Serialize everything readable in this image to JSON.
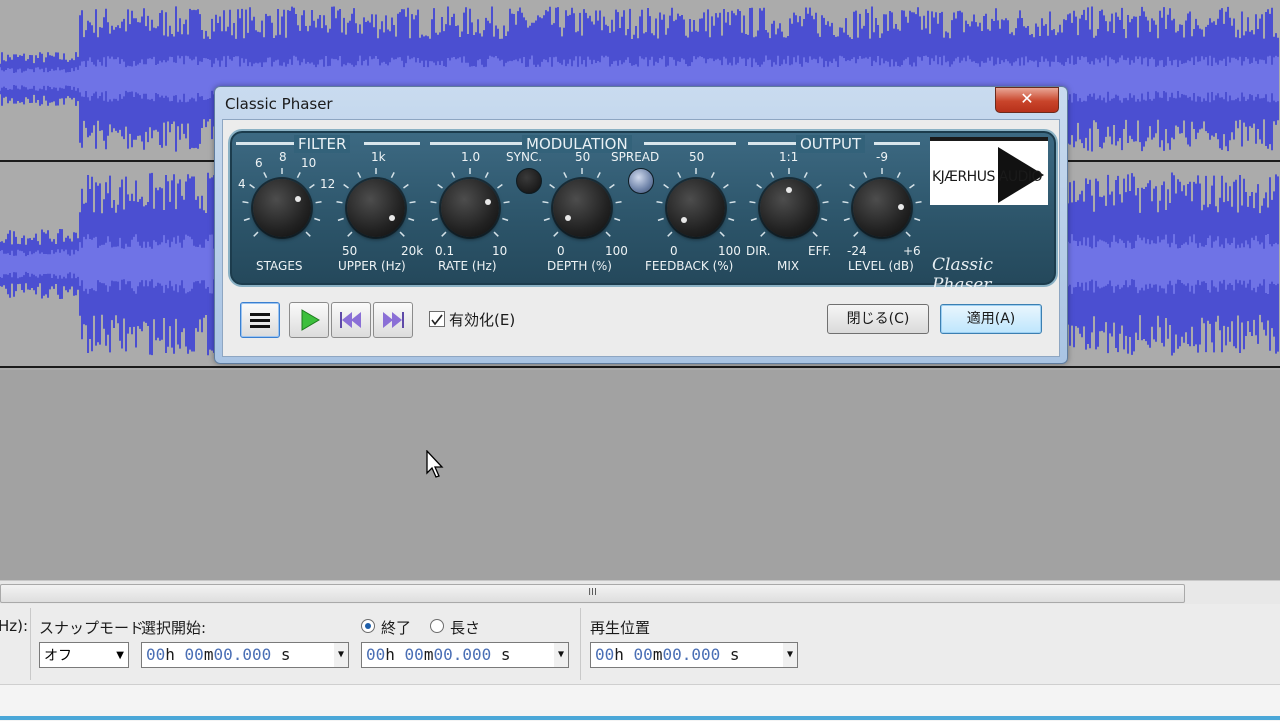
{
  "dialog": {
    "title": "Classic Phaser",
    "close_glyph": "✕",
    "sections": {
      "filter": "FILTER",
      "modulation": "MODULATION",
      "output": "OUTPUT"
    },
    "knobs": {
      "stages": {
        "label": "STAGES",
        "scale": [
          "4",
          "6",
          "8",
          "10",
          "12"
        ]
      },
      "upper": {
        "label": "UPPER (Hz)",
        "top": "1k",
        "min": "50",
        "max": "20k"
      },
      "rate": {
        "label": "RATE (Hz)",
        "top": "1.0",
        "min": "0.1",
        "max": "10"
      },
      "depth": {
        "label": "DEPTH (%)",
        "top": "50",
        "min": "0",
        "max": "100"
      },
      "feedback": {
        "label": "FEEDBACK (%)",
        "top": "50",
        "min": "0",
        "max": "100"
      },
      "mix": {
        "label": "MIX",
        "top": "1:1",
        "min": "DIR.",
        "max": "EFF."
      },
      "level": {
        "label": "LEVEL (dB)",
        "top": "-9",
        "min": "-24",
        "max": "+6"
      }
    },
    "sync_label": "SYNC.",
    "spread_label": "SPREAD",
    "logo_text": "KJÆRHUS AUDIO",
    "product_script": "Classic Phaser",
    "enable_label": "有効化(E)",
    "enable_checked": true,
    "close_button": "閉じる(C)",
    "apply_button": "適用(A)",
    "colors": {
      "panel": "#2f5a70",
      "led_sync": "#111111",
      "led_spread": "#7f93b8"
    }
  },
  "icons": [
    "menu-icon",
    "play-icon",
    "rewind-icon",
    "fast-forward-icon",
    "close-icon",
    "cursor-icon"
  ],
  "scrollbar": {
    "grip": "III"
  },
  "selection_toolbar": {
    "rate_label_fragment": "Hz):",
    "snap_mode_label": "スナップモード",
    "snap_mode_value": "オフ",
    "selection_start_label": "選択開始:",
    "end_radio_label": "終了",
    "length_radio_label": "長さ",
    "end_selected": true,
    "play_position_label": "再生位置",
    "time_fields": [
      {
        "h": "00",
        "m": "00",
        "s": "00.000"
      },
      {
        "h": "00",
        "m": "00",
        "s": "00.000"
      },
      {
        "h": "00",
        "m": "00",
        "s": "00.000"
      }
    ],
    "units": {
      "h": "h",
      "m": "m",
      "s": "s"
    }
  }
}
